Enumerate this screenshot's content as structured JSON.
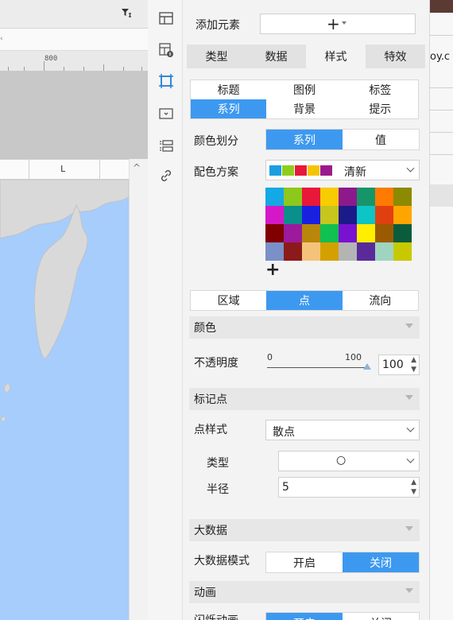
{
  "left": {
    "ruler_number": "800",
    "column_header": "L"
  },
  "panel": {
    "add_element_label": "添加元素",
    "add_symbol": "+",
    "main_tabs": [
      "类型",
      "数据",
      "样式",
      "特效"
    ],
    "sub_tabs_row1": [
      "标题",
      "图例",
      "标签"
    ],
    "sub_tabs_row2": [
      "系列",
      "背景",
      "提示"
    ],
    "color_divide": {
      "label": "颜色划分",
      "options": [
        "系列",
        "值"
      ]
    },
    "color_scheme": {
      "label": "配色方案",
      "value": "清新",
      "swatch_colors": [
        "#1a9ee0",
        "#8fcd1a",
        "#e8183a",
        "#f5c400",
        "#9a1a8c"
      ]
    },
    "palette_colors": [
      "#14a8e5",
      "#8dc81c",
      "#e8183a",
      "#f7cc00",
      "#8c1a8c",
      "#17956a",
      "#ff7a00",
      "#8c8a00",
      "#d418c8",
      "#0a8f8a",
      "#1a20e0",
      "#c6c61c",
      "#1a1a8a",
      "#0dc5c5",
      "#e0400f",
      "#ffa500",
      "#800000",
      "#9c1a9c",
      "#b8860b",
      "#10c050",
      "#7a10d0",
      "#ffee00",
      "#9c5a00",
      "#0a5c3c",
      "#7a90c8",
      "#8c1a1a",
      "#f5c27a",
      "#d4a000",
      "#b4b4b4",
      "#5a2a9a",
      "#9ed4c0",
      "#c8c800"
    ],
    "add_color_symbol": "+",
    "layer_tabs": [
      "区域",
      "点",
      "流向"
    ],
    "section_color": "颜色",
    "opacity": {
      "label": "不透明度",
      "min": "0",
      "max": "100",
      "value": "100",
      "level": 1.0
    },
    "section_marker": "标记点",
    "point_style": {
      "label": "点样式",
      "value": "散点"
    },
    "marker_type": {
      "label": "类型",
      "symbol": "○"
    },
    "radius": {
      "label": "半径",
      "value": "5"
    },
    "section_bigdata": "大数据",
    "bigdata_mode": {
      "label": "大数据模式",
      "options": [
        "开启",
        "关闭"
      ]
    },
    "section_animation": "动画",
    "flash_animation": {
      "label": "闪烁动画",
      "options": [
        "开启",
        "关闭"
      ]
    }
  },
  "rstrip": {
    "url_fragment": "oy.c"
  },
  "colors": {
    "accent": "#3d99f0",
    "map_water": "#a6cdfc",
    "land": "#d9d9d9"
  }
}
